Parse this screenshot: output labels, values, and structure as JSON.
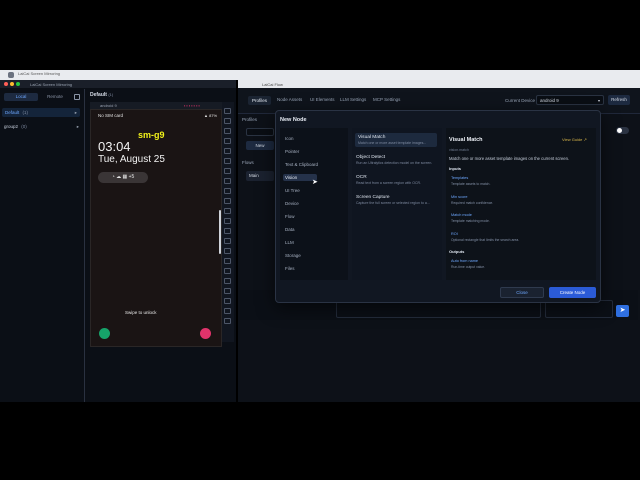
{
  "topbar": {
    "items": [
      "LaiCai Screen Mirroring",
      "",
      "",
      "",
      "",
      ""
    ]
  },
  "left_window": {
    "title": "LaiCai Screen Mirroring",
    "tabs": [
      {
        "label": "Local"
      },
      {
        "label": "Remote"
      }
    ],
    "groups": [
      {
        "label": "Default",
        "count": "(1)",
        "active": true
      },
      {
        "label": "group2",
        "count": "(0)",
        "active": false
      }
    ],
    "device_panel_title": "Default",
    "device_panel_count": "(1)",
    "phonebar_label": "android 9",
    "phone": {
      "sim": "No SIM card",
      "battery": "▲ 87%",
      "device_name": "sm-g9",
      "time": "03:04",
      "date": "Tue, August 25",
      "notif_extra": "+5",
      "swipe": "Swipe to unlock"
    }
  },
  "right_window": {
    "title": "LaiCai Flow",
    "nav": [
      {
        "label": "Profiles",
        "active": true
      },
      {
        "label": "Node Assets",
        "active": false
      },
      {
        "label": "UI Elements",
        "active": false
      },
      {
        "label": "LLM Settings",
        "active": false
      },
      {
        "label": "MCP Settings",
        "active": false
      }
    ],
    "current_device_label": "Current Device",
    "current_device_value": "android 9",
    "refresh_label": "Refresh",
    "left_labels": {
      "profiles": "Profiles",
      "new": "New",
      "flows": "Flows",
      "main": "Main"
    }
  },
  "modal": {
    "title": "New Node",
    "categories": [
      {
        "label": "Icon",
        "active": false
      },
      {
        "label": "Pointer",
        "active": false
      },
      {
        "label": "Text & Clipboard",
        "active": false
      },
      {
        "label": "Vision",
        "active": true
      },
      {
        "label": "UI Tree",
        "active": false
      },
      {
        "label": "Device",
        "active": false
      },
      {
        "label": "Flow",
        "active": false
      },
      {
        "label": "Data",
        "active": false
      },
      {
        "label": "LLM",
        "active": false
      },
      {
        "label": "Storage",
        "active": false
      },
      {
        "label": "Files",
        "active": false
      }
    ],
    "nodes": [
      {
        "name": "Visual Match",
        "desc": "Match one or more asset template images...",
        "active": true
      },
      {
        "name": "Object Detect",
        "desc": "Run an Ultralytics detection model on the screen.",
        "active": false
      },
      {
        "name": "OCR",
        "desc": "Read text from a screen region with OCR.",
        "active": false
      },
      {
        "name": "Screen Capture",
        "desc": "Capture the full screen or selected region to a...",
        "active": false
      }
    ],
    "detail": {
      "title": "Visual Match",
      "guide": "View Guide ↗",
      "subtitle": "vision.match",
      "description": "Match one or more asset template images on the current screen.",
      "inputs_label": "Inputs",
      "inputs": [
        {
          "key": "Templates",
          "val": "Template assets to match."
        },
        {
          "key": "Min score",
          "val": "Required match confidence."
        },
        {
          "key": "Match mode",
          "val": "Template matching mode."
        },
        {
          "key": "ROI",
          "val": "Optional rectangle that limits the search area."
        }
      ],
      "outputs_label": "Outputs",
      "outputs": [
        {
          "key": "Auto from name",
          "val": "Run-time output value."
        }
      ]
    },
    "close_label": "Close",
    "create_label": "Create Node"
  }
}
